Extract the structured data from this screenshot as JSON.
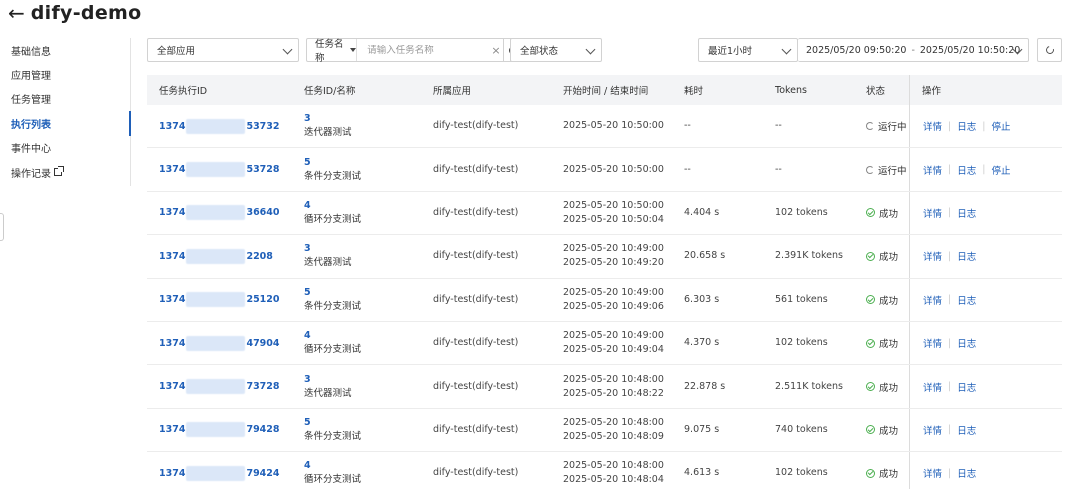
{
  "header": {
    "back_icon": "arrow-left-icon",
    "title": "dify-demo"
  },
  "sidebar": {
    "items": [
      {
        "label": "基础信息"
      },
      {
        "label": "应用管理"
      },
      {
        "label": "任务管理"
      },
      {
        "label": "执行列表",
        "active": true
      },
      {
        "label": "事件中心"
      },
      {
        "label": "操作记录",
        "icon": "external-link-icon"
      }
    ]
  },
  "filters": {
    "app_select": "全部应用",
    "task_type": "任务名称",
    "task_placeholder": "请输入任务名称",
    "clear_icon": "close-icon",
    "search_icon": "search-icon",
    "status_select": "全部状态",
    "range_select": "最近1小时",
    "date_start": "2025/05/20 09:50:20",
    "date_sep": "-",
    "date_end": "2025/05/20 10:50:20",
    "refresh_icon": "refresh-icon"
  },
  "table": {
    "headers": {
      "id": "任务执行ID",
      "task": "任务ID/名称",
      "app": "所属应用",
      "time": "开始时间 / 结束时间",
      "duration": "耗时",
      "tokens": "Tokens",
      "status": "状态",
      "actions": "操作"
    },
    "rows": [
      {
        "id_prefix": "1374",
        "id_suffix": "53732",
        "task_id": "3",
        "task_name": "迭代器测试",
        "app": "dify-test(dify-test)",
        "start": "2025-05-20 10:50:00",
        "end": "",
        "duration": "--",
        "tokens": "--",
        "status": "运行中",
        "status_kind": "running",
        "act_detail": "详情",
        "act_log": "日志",
        "act_stop": "停止"
      },
      {
        "id_prefix": "1374",
        "id_suffix": "53728",
        "task_id": "5",
        "task_name": "条件分支测试",
        "app": "dify-test(dify-test)",
        "start": "2025-05-20 10:50:00",
        "end": "",
        "duration": "--",
        "tokens": "--",
        "status": "运行中",
        "status_kind": "running",
        "act_detail": "详情",
        "act_log": "日志",
        "act_stop": "停止"
      },
      {
        "id_prefix": "1374",
        "id_suffix": "36640",
        "task_id": "4",
        "task_name": "循环分支测试",
        "app": "dify-test(dify-test)",
        "start": "2025-05-20 10:50:00",
        "end": "2025-05-20 10:50:04",
        "duration": "4.404 s",
        "tokens": "102 tokens",
        "status": "成功",
        "status_kind": "success",
        "act_detail": "详情",
        "act_log": "日志",
        "act_stop": ""
      },
      {
        "id_prefix": "1374",
        "id_suffix": "2208",
        "task_id": "3",
        "task_name": "迭代器测试",
        "app": "dify-test(dify-test)",
        "start": "2025-05-20 10:49:00",
        "end": "2025-05-20 10:49:20",
        "duration": "20.658 s",
        "tokens": "2.391K tokens",
        "status": "成功",
        "status_kind": "success",
        "act_detail": "详情",
        "act_log": "日志",
        "act_stop": ""
      },
      {
        "id_prefix": "1374",
        "id_suffix": "25120",
        "task_id": "5",
        "task_name": "条件分支测试",
        "app": "dify-test(dify-test)",
        "start": "2025-05-20 10:49:00",
        "end": "2025-05-20 10:49:06",
        "duration": "6.303 s",
        "tokens": "561 tokens",
        "status": "成功",
        "status_kind": "success",
        "act_detail": "详情",
        "act_log": "日志",
        "act_stop": ""
      },
      {
        "id_prefix": "1374",
        "id_suffix": "47904",
        "task_id": "4",
        "task_name": "循环分支测试",
        "app": "dify-test(dify-test)",
        "start": "2025-05-20 10:49:00",
        "end": "2025-05-20 10:49:04",
        "duration": "4.370 s",
        "tokens": "102 tokens",
        "status": "成功",
        "status_kind": "success",
        "act_detail": "详情",
        "act_log": "日志",
        "act_stop": ""
      },
      {
        "id_prefix": "1374",
        "id_suffix": "73728",
        "task_id": "3",
        "task_name": "迭代器测试",
        "app": "dify-test(dify-test)",
        "start": "2025-05-20 10:48:00",
        "end": "2025-05-20 10:48:22",
        "duration": "22.878 s",
        "tokens": "2.511K tokens",
        "status": "成功",
        "status_kind": "success",
        "act_detail": "详情",
        "act_log": "日志",
        "act_stop": ""
      },
      {
        "id_prefix": "1374",
        "id_suffix": "79428",
        "task_id": "5",
        "task_name": "条件分支测试",
        "app": "dify-test(dify-test)",
        "start": "2025-05-20 10:48:00",
        "end": "2025-05-20 10:48:09",
        "duration": "9.075 s",
        "tokens": "740 tokens",
        "status": "成功",
        "status_kind": "success",
        "act_detail": "详情",
        "act_log": "日志",
        "act_stop": ""
      },
      {
        "id_prefix": "1374",
        "id_suffix": "79424",
        "task_id": "4",
        "task_name": "循环分支测试",
        "app": "dify-test(dify-test)",
        "start": "2025-05-20 10:48:00",
        "end": "2025-05-20 10:48:04",
        "duration": "4.613 s",
        "tokens": "102 tokens",
        "status": "成功",
        "status_kind": "success",
        "act_detail": "详情",
        "act_log": "日志",
        "act_stop": ""
      }
    ]
  },
  "colors": {
    "accent": "#1f5fb8",
    "success": "#4caf50",
    "header_bg": "#f3f4f6"
  }
}
